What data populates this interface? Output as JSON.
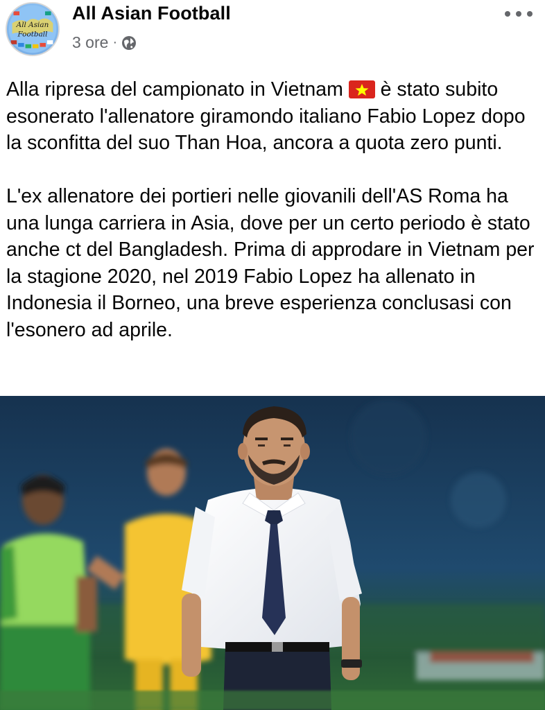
{
  "post": {
    "author": "All Asian Football",
    "avatar_text": [
      "All Asian",
      "Football"
    ],
    "time": "3 ore",
    "separator": "·",
    "privacy_icon": "globe-icon",
    "more_icon": "more-options-icon",
    "paragraph1_a": "Alla ripresa del campionato in Vietnam ",
    "paragraph1_flag": "vietnam-flag-icon",
    "paragraph1_b": " è stato subito esonerato l'allenatore giramondo italiano Fabio Lopez dopo la sconfitta del suo Than Hoa, ancora a quota zero punti.",
    "paragraph2": "L'ex allenatore dei portieri nelle giovanili dell'AS Roma ha una lunga carriera in Asia, dove per un certo periodo è stato anche ct del Bangladesh. Prima di approdare in Vietnam per la stagione 2020, nel 2019 Fabio Lopez ha allenato in Indonesia il Borneo, una breve esperienza conclusasi con l'esonero ad aprile."
  },
  "colors": {
    "text": "#050505",
    "meta": "#65676b",
    "flag_red": "#da251d",
    "flag_star": "#ffff00"
  }
}
